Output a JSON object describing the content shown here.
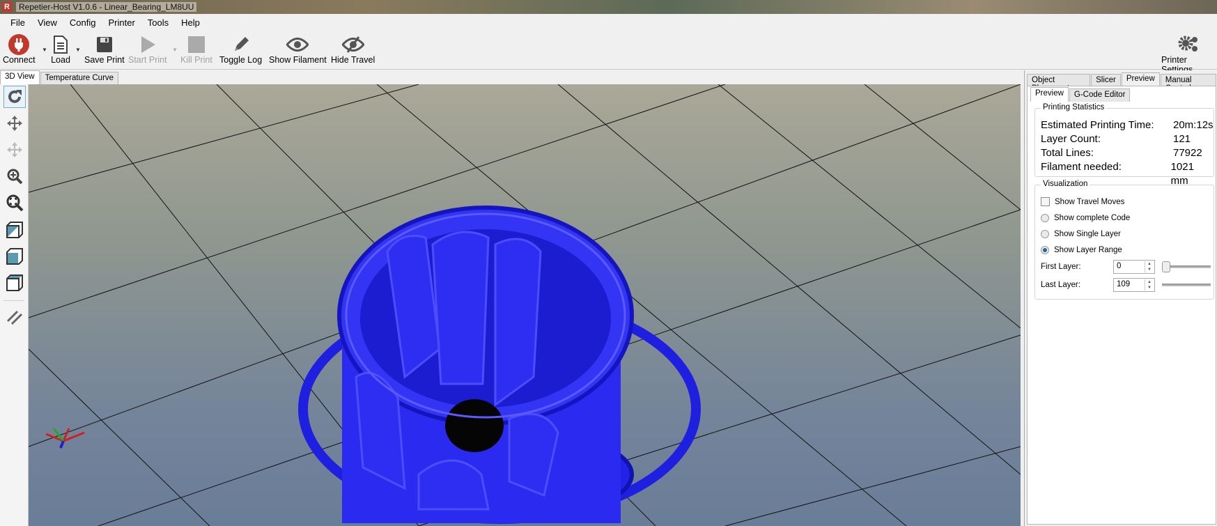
{
  "window": {
    "title": "Repetier-Host V1.0.6 - Linear_Bearing_LM8UU",
    "app_icon": "R"
  },
  "menu": [
    "File",
    "View",
    "Config",
    "Printer",
    "Tools",
    "Help"
  ],
  "toolbar": {
    "connect": "Connect",
    "load": "Load",
    "save_print": "Save Print",
    "start_print": "Start Print",
    "kill_print": "Kill Print",
    "toggle_log": "Toggle Log",
    "show_filament": "Show Filament",
    "hide_travel": "Hide Travel",
    "printer_settings": "Printer Settings"
  },
  "view_tabs": [
    "3D View",
    "Temperature Curve"
  ],
  "right_tabs": [
    "Object Placement",
    "Slicer",
    "Preview",
    "Manual Control"
  ],
  "preview_tabs": [
    "Preview",
    "G-Code Editor"
  ],
  "stats": {
    "legend": "Printing Statistics",
    "rows": [
      {
        "label": "Estimated Printing Time:",
        "value": "20m:12s"
      },
      {
        "label": "Layer Count:",
        "value": "121"
      },
      {
        "label": "Total Lines:",
        "value": "77922"
      },
      {
        "label": "Filament needed:",
        "value": "1021 mm"
      }
    ]
  },
  "visualization": {
    "legend": "Visualization",
    "show_travel": "Show Travel Moves",
    "complete": "Show complete Code",
    "single": "Show Single Layer",
    "range": "Show Layer Range",
    "first_label": "First Layer:",
    "first_value": "0",
    "last_label": "Last Layer:",
    "last_value": "109"
  },
  "colors": {
    "model": "#2b2bf0",
    "connect": "#c0392b"
  }
}
